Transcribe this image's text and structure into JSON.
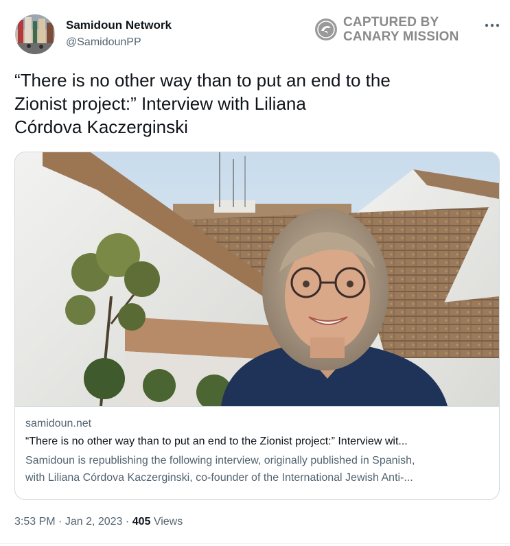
{
  "author": {
    "name": "Samidoun Network",
    "handle": "@SamidounPP"
  },
  "watermark": {
    "line1": "CAPTURED BY",
    "line2": "CANARY MISSION",
    "icon": "canary-mission-seal-icon"
  },
  "menu": {
    "icon": "more-horizontal-icon",
    "label": "•••"
  },
  "tweet": {
    "text_line1": "“There is no other way than to put an end to the",
    "text_line2": "Zionist project:” Interview with Liliana",
    "text_line3": "Córdova Kaczerginski"
  },
  "card": {
    "image": "photo-woman-with-glasses-on-rooftop",
    "domain": "samidoun.net",
    "title": "“There is no other way than to put an end to the Zionist project:” Interview wit...",
    "description_line1": "Samidoun is republishing the following interview, originally published in Spanish,",
    "description_line2": "with Liliana Córdova Kaczerginski, co-founder of the International Jewish Anti-..."
  },
  "meta": {
    "time": "3:53 PM",
    "separator": "·",
    "date": "Jan 2, 2023",
    "views_count": "405",
    "views_label": "Views"
  },
  "colors": {
    "text_primary": "#0f1419",
    "text_secondary": "#536471",
    "border": "#cfd9de",
    "watermark": "#8a8a8a"
  }
}
